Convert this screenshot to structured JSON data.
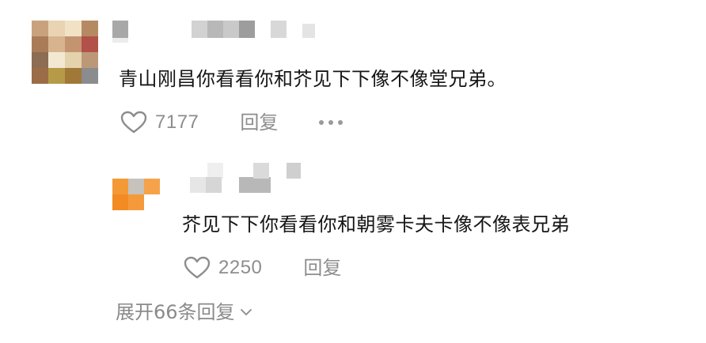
{
  "comments": [
    {
      "text": "青山刚昌你看看你和芥见下下像不像堂兄弟。",
      "likes": "7177",
      "reply_label": "回复",
      "more_icon": "more-dots-icon"
    },
    {
      "text": "芥见下下你看看你和朝雾卡夫卡像不像表兄弟",
      "likes": "2250",
      "reply_label": "回复"
    }
  ],
  "expand_replies": {
    "label": "展开66条回复",
    "icon": "chevron-down-icon"
  },
  "colors": {
    "text": "#151515",
    "secondary": "#8d8d8d",
    "avatar2_accent": "#f39a36"
  }
}
